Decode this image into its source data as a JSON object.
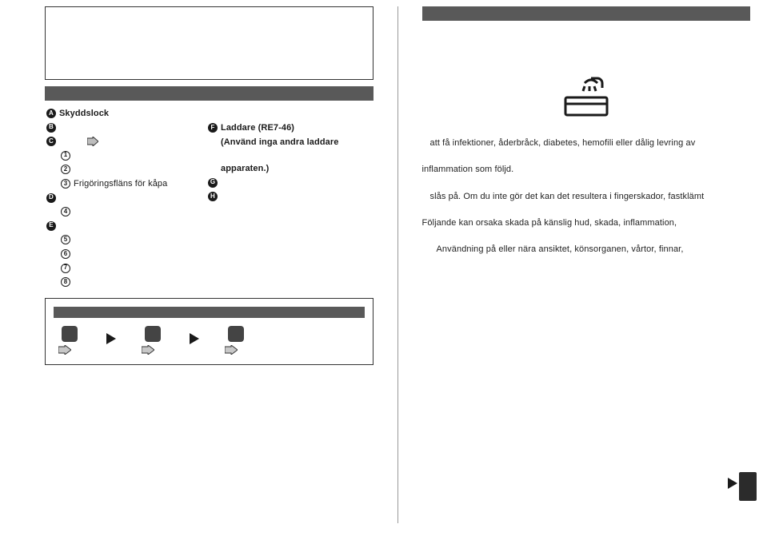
{
  "left": {
    "parts": {
      "A": "Skyddslock",
      "C3": "Frigöringsfläns för kåpa",
      "F_line1": "Laddare (RE7-46)",
      "F_line2": "(Använd inga andra laddare",
      "F_line3": "apparaten.)"
    }
  },
  "right": {
    "p1": "att få infektioner, åderbråck, diabetes, hemofili eller dålig levring av",
    "p2": "inflammation som följd.",
    "p3": "slås på. Om du inte gör det kan det resultera i fingerskador, fastklämt",
    "p4": "Följande kan orsaka skada på känslig hud, skada, inflammation,",
    "p5": "Användning på eller nära ansiktet, könsorganen, vårtor, finnar,"
  }
}
